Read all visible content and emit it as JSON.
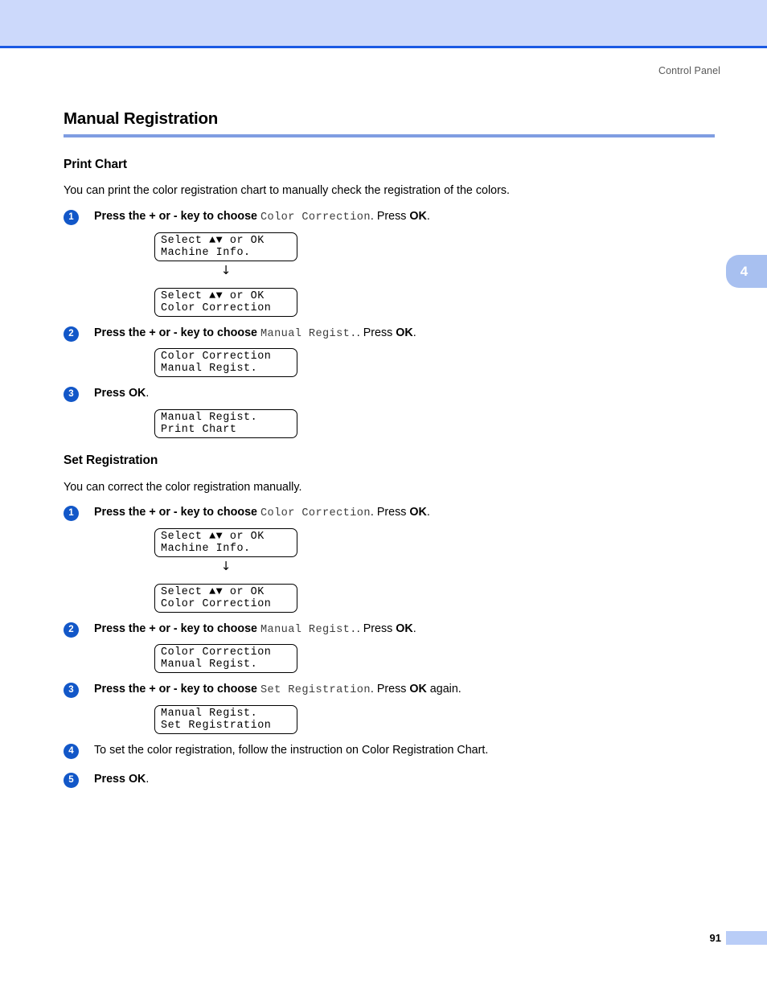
{
  "page": {
    "running_head": "Control Panel",
    "chapter_tab": "4",
    "page_number": "91",
    "title": "Manual Registration",
    "colors": {
      "header_band": "#ccd9fb",
      "header_rule": "#1a5ae4",
      "title_rule": "#7f9de2",
      "bullet": "#1257c8",
      "chapter_tab": "#a8c0f0",
      "footer_bar": "#b9cdf7"
    }
  },
  "sections": [
    {
      "heading": "Print Chart",
      "intro": "You can print the color registration chart to manually check the registration of the colors.",
      "steps": [
        {
          "number": "1",
          "prefix": "Press the + or - key to choose ",
          "command": "Color Correction",
          "suffix": ". Press ",
          "key": "OK",
          "tail": "."
        },
        {
          "number": "2",
          "prefix": "Press the + or - key to choose ",
          "command": "Manual Regist.",
          "suffix": ". Press ",
          "key": "OK",
          "tail": "."
        },
        {
          "number": "3",
          "prefix": "Press ",
          "command": "",
          "suffix": "",
          "key": "OK",
          "tail": "."
        }
      ],
      "lcds": [
        {
          "line1": "Select ▲▼ or OK",
          "line2": "Machine Info."
        },
        {
          "line1": "Select ▲▼ or OK",
          "line2": "Color Correction"
        },
        {
          "line1": "Color Correction",
          "line2": "Manual Regist."
        },
        {
          "line1": "Manual Regist.",
          "line2": "Print Chart"
        }
      ]
    },
    {
      "heading": "Set Registration",
      "intro": "You can correct the color registration manually.",
      "steps": [
        {
          "number": "1",
          "prefix": "Press the + or - key to choose ",
          "command": "Color Correction",
          "suffix": ". Press ",
          "key": "OK",
          "tail": "."
        },
        {
          "number": "2",
          "prefix": "Press the + or - key to choose ",
          "command": "Manual Regist.",
          "suffix": ". Press ",
          "key": "OK",
          "tail": "."
        },
        {
          "number": "3",
          "prefix": "Press the + or - key to choose ",
          "command": "Set Registration",
          "suffix": ". Press ",
          "key": "OK",
          "tail": " again."
        },
        {
          "number": "4",
          "plain": "To set the color registration, follow the instruction on Color Registration Chart."
        },
        {
          "number": "5",
          "prefix": "Press ",
          "command": "",
          "suffix": "",
          "key": "OK",
          "tail": "."
        }
      ],
      "lcds": [
        {
          "line1": "Select ▲▼ or OK",
          "line2": "Machine Info."
        },
        {
          "line1": "Select ▲▼ or OK",
          "line2": "Color Correction"
        },
        {
          "line1": "Color Correction",
          "line2": "Manual Regist."
        },
        {
          "line1": "Manual Regist.",
          "line2": "Set Registration"
        }
      ]
    }
  ],
  "arrow_glyph": "↓"
}
